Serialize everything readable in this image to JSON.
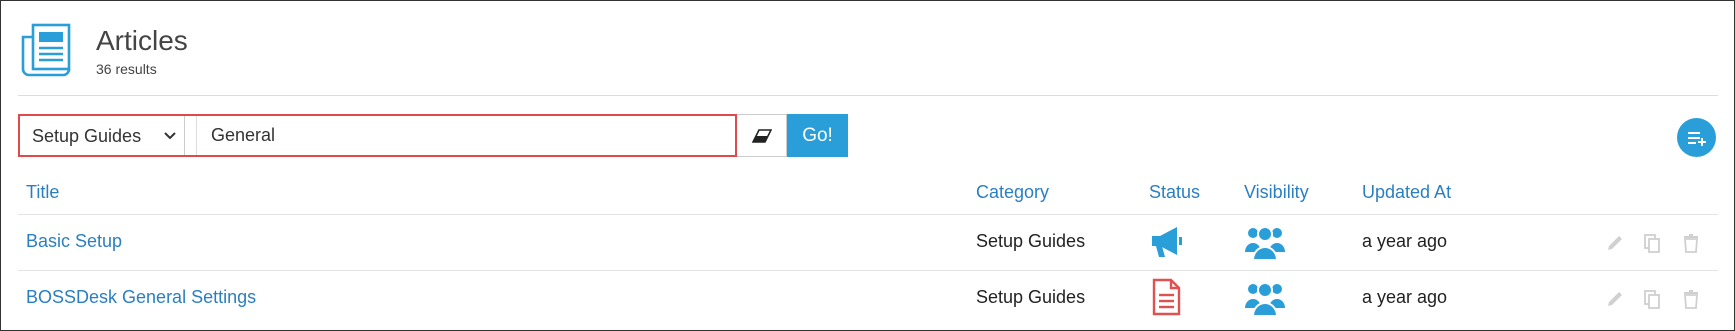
{
  "header": {
    "title": "Articles",
    "results": "36 results",
    "icon": "newspaper-icon"
  },
  "search": {
    "category_selected": "Setup Guides",
    "query_value": "General",
    "clear_icon": "eraser-icon",
    "go_label": "Go!",
    "add_icon": "playlist-add-icon"
  },
  "table": {
    "columns": [
      "Title",
      "Category",
      "Status",
      "Visibility",
      "Updated At"
    ],
    "rows": [
      {
        "title": "Basic Setup",
        "category": "Setup Guides",
        "status_icon": "megaphone-icon",
        "visibility_icon": "users-icon",
        "updated": "a year ago"
      },
      {
        "title": "BOSSDesk General Settings",
        "category": "Setup Guides",
        "status_icon": "document-icon",
        "visibility_icon": "users-icon",
        "updated": "a year ago"
      }
    ]
  },
  "colors": {
    "accent": "#2a9ed8",
    "link": "#2a7fc0",
    "highlight_border": "#e04a4a",
    "draft_red": "#e05252"
  }
}
